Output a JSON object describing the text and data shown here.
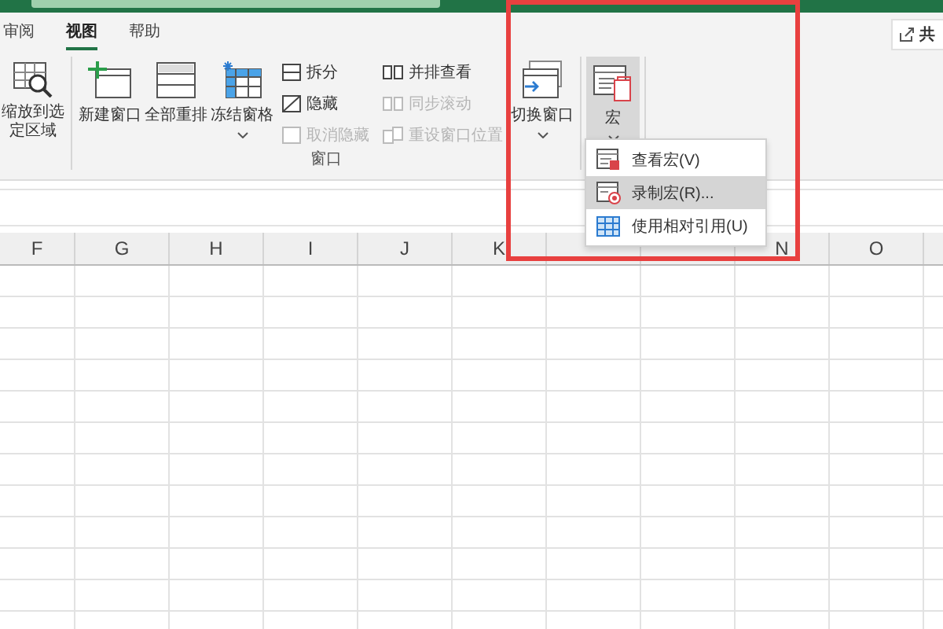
{
  "tabs": [
    {
      "label": "审阅",
      "selected": false
    },
    {
      "label": "视图",
      "selected": true
    },
    {
      "label": "帮助",
      "selected": false
    }
  ],
  "share_button": {
    "label": "共"
  },
  "ribbon_groups": [
    {
      "items": [
        {
          "kind": "large",
          "label": "缩放到选定区域"
        }
      ]
    },
    {
      "label": "窗口",
      "items": [
        {
          "kind": "large",
          "label": "新建窗口"
        },
        {
          "kind": "large",
          "label": "全部重排"
        },
        {
          "kind": "large",
          "label": "冻结窗格",
          "dropdown": true
        },
        {
          "kind": "stack",
          "items": [
            {
              "label": "拆分",
              "disabled": false
            },
            {
              "label": "隐藏",
              "disabled": false
            },
            {
              "label": "取消隐藏",
              "disabled": true
            }
          ]
        },
        {
          "kind": "stack",
          "items": [
            {
              "label": "并排查看",
              "disabled": false
            },
            {
              "label": "同步滚动",
              "disabled": true
            },
            {
              "label": "重设窗口位置",
              "disabled": true
            }
          ]
        },
        {
          "kind": "large",
          "label": "切换窗口",
          "dropdown": true
        }
      ]
    },
    {
      "items": [
        {
          "kind": "large",
          "label": "宏",
          "dropdown": true,
          "pressed": true
        }
      ]
    }
  ],
  "macro_menu": {
    "items": [
      {
        "label": "查看宏(V)",
        "selected": false
      },
      {
        "label": "录制宏(R)...",
        "selected": true
      },
      {
        "label": "使用相对引用(U)",
        "selected": false
      }
    ]
  },
  "columns": [
    "F",
    "G",
    "H",
    "I",
    "J",
    "K",
    null,
    null,
    "N",
    "O"
  ]
}
